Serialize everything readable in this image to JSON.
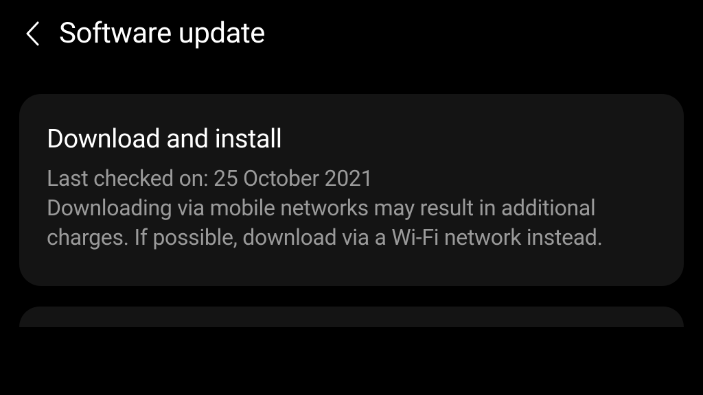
{
  "header": {
    "title": "Software update"
  },
  "card": {
    "title": "Download and install",
    "last_checked_label": "Last checked on: 25 October 2021",
    "description": "Downloading via mobile networks may result in additional charges. If possible, download via a Wi-Fi network instead."
  }
}
